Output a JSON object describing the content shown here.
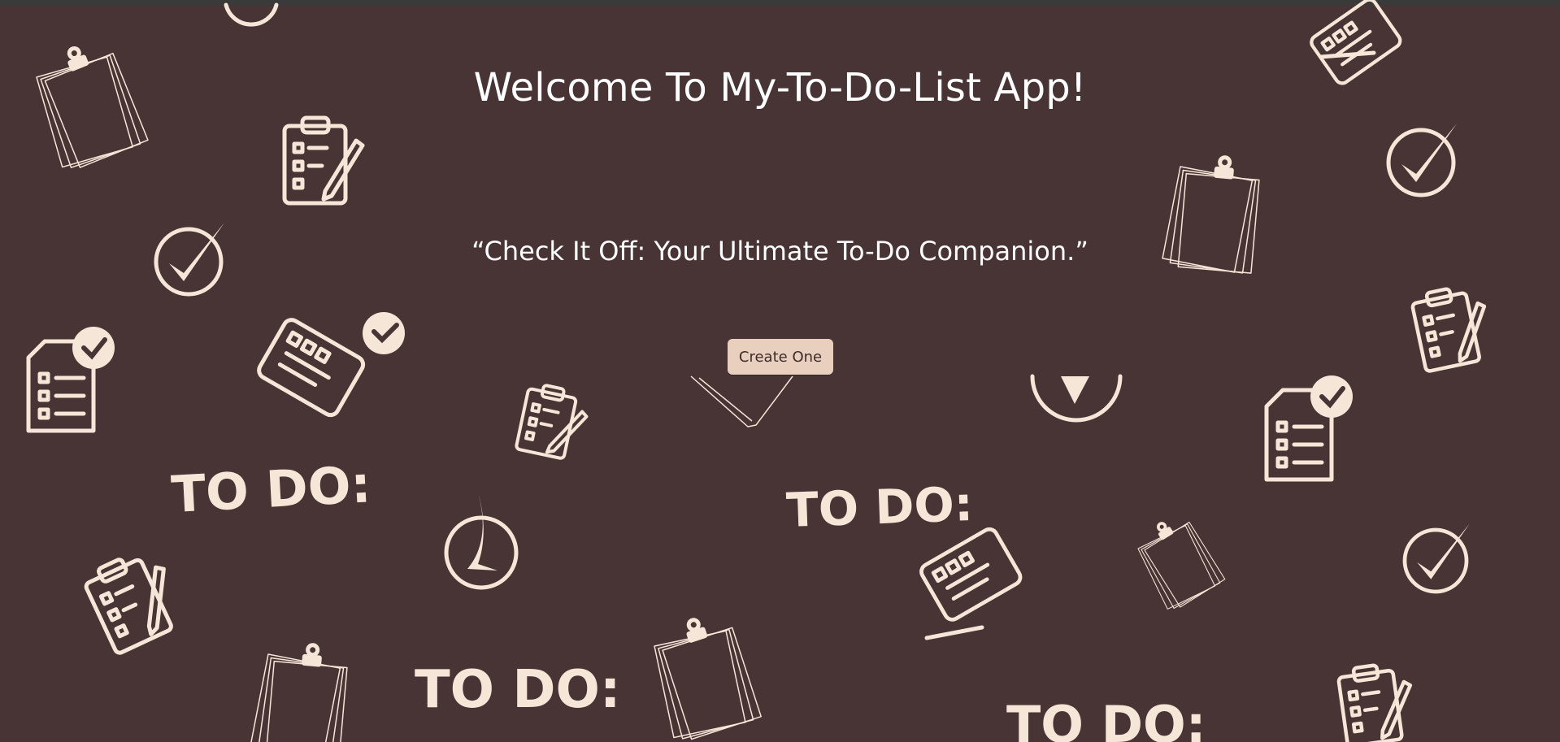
{
  "page": {
    "title": "Welcome To My-To-Do-List App!",
    "tagline": "“Check It Off: Your Ultimate To-Do Companion.”",
    "cta_label": "Create One",
    "pattern_text": "TO DO:"
  },
  "colors": {
    "background": "#483335",
    "accent_button": "#e9cfbe",
    "icon_color": "#f6e6d8",
    "text": "#ffffff"
  },
  "icons": [
    "notepad-icon",
    "clipboard-checklist-icon",
    "checkmark-circle-icon",
    "checklist-pencil-icon",
    "document-check-icon",
    "todo-lettering"
  ]
}
